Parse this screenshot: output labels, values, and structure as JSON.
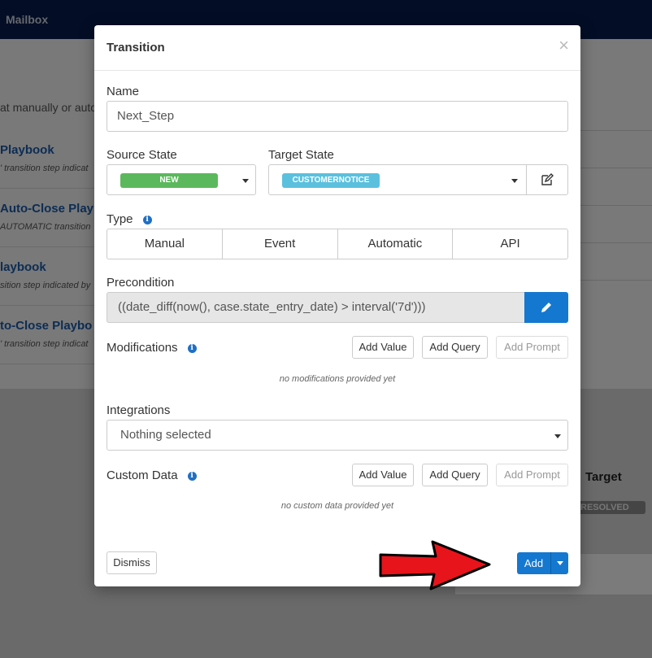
{
  "app": {
    "title": "Mailbox",
    "description_fragment": "at manually or auto",
    "playbooks": [
      {
        "title": "Playbook",
        "subtitle": "' transition step indicat"
      },
      {
        "title": "Auto-Close Playb",
        "subtitle": "AUTOMATIC transition"
      },
      {
        "title": "laybook",
        "subtitle": "sition step indicated by"
      },
      {
        "title": "to-Close Playbo",
        "subtitle": "' transition step indicat"
      }
    ],
    "target_header": "Target",
    "status_pill": "RESOLVED"
  },
  "modal": {
    "title": "Transition",
    "close_glyph": "×",
    "name": {
      "label": "Name",
      "value": "Next_Step"
    },
    "source_state": {
      "label": "Source State",
      "value": "NEW",
      "color": "#5cb85c"
    },
    "target_state": {
      "label": "Target State",
      "value": "CUSTOMERNOTICE",
      "color": "#5bc0de"
    },
    "type": {
      "label": "Type",
      "options": [
        "Manual",
        "Event",
        "Automatic",
        "API"
      ]
    },
    "precondition": {
      "label": "Precondition",
      "value": "((date_diff(now(), case.state_entry_date) > interval('7d')))"
    },
    "modifications": {
      "label": "Modifications",
      "buttons": {
        "add_value": "Add Value",
        "add_query": "Add Query",
        "add_prompt": "Add Prompt"
      },
      "empty": "no modifications provided yet"
    },
    "integrations": {
      "label": "Integrations",
      "value": "Nothing selected"
    },
    "custom_data": {
      "label": "Custom Data",
      "buttons": {
        "add_value": "Add Value",
        "add_query": "Add Query",
        "add_prompt": "Add Prompt"
      },
      "empty": "no custom data provided yet"
    },
    "footer": {
      "dismiss": "Dismiss",
      "add": "Add"
    }
  },
  "colors": {
    "primary": "#1478d0",
    "arrow": "#e8141b",
    "navbar": "#061a4a"
  },
  "icons": [
    "info-icon",
    "edit-icon",
    "pencil-icon",
    "chevron-down-icon",
    "close-icon"
  ]
}
